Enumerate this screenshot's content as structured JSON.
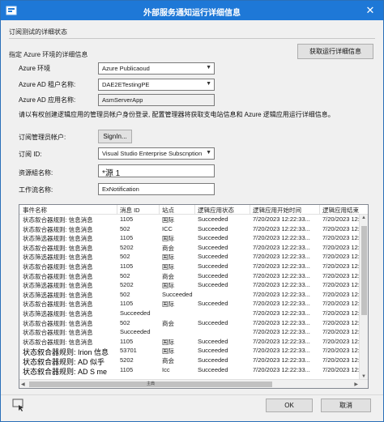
{
  "window": {
    "title": "外部服务通知运行详细信息",
    "close_glyph": "✕"
  },
  "subscription_section": "订阅测试的详细状态",
  "azure_section": "指定 Azure 环境的详细信息",
  "get_details_button": "获取运行详细信息",
  "form": {
    "env_label": "Azure 环境",
    "env_value": "Azure Publicaoud",
    "tenant_label": "Azure AD 租户名称:",
    "tenant_value": "DAE2ETestingPE",
    "app_label": "Azure AD 应用名称:",
    "app_value": "AsmServerApp",
    "note": "请以有权创建逻辑应用的管理员帐户身份登录, 配置管理器将获取支电站信息和 Azure 逻辑应用运行详细信息。",
    "admin_label": "订阅管理员帐户:",
    "signin_label": "SignIn...",
    "sub_id_label": "订阅 ID:",
    "sub_id_value": "Visual Studio Enterprise Subscnption",
    "rg_label": "资源組名称:",
    "rg_value": "*源 1",
    "workflow_label": "工作流名称:",
    "workflow_value": "ExNotification"
  },
  "grid": {
    "columns": [
      "事件名称",
      "消息 ID",
      "站点",
      "逻辑应用状态",
      "逻辑应用开始时间",
      "逻辑应用结束"
    ],
    "rows": [
      {
        "event": "状态叙合器规则: 信息消息",
        "msg": "1105",
        "site": "国际",
        "status": "Succeeded",
        "start": "7/20/2023 12:22:33...",
        "end": "7/20/2023 12:23:"
      },
      {
        "event": "状态叙合器规则: 信息消息",
        "msg": "502",
        "site": "ICC",
        "status": "Succeeded",
        "start": "7/20/2023 12:22:33...",
        "end": "7/20/2023 12:22:"
      },
      {
        "event": "状态筛选器规则: 信息消息",
        "msg": "1105",
        "site": "国际",
        "status": "Succeeded",
        "start": "7/20/2023 12:22:33...",
        "end": "7/20/2023 12:22:"
      },
      {
        "event": "状态叙合器规则: 信息消息",
        "msg": "5202",
        "site": "商会",
        "status": "Succeeded",
        "start": "7/20/2023 12:22:33...",
        "end": "7/20/2023 12:22:"
      },
      {
        "event": "状态筛选器规则: 信息消息",
        "msg": "502",
        "site": "国际",
        "status": "Succeeded",
        "start": "7/20/2023 12:22:33...",
        "end": "7/20/2023 12:22:"
      },
      {
        "event": "状态叙合器规则: 信息消息",
        "msg": "1105",
        "site": "国际",
        "status": "Succeeded",
        "start": "7/20/2023 12:22:33...",
        "end": "7/20/2023 12:22:"
      },
      {
        "event": "状态叙合器规则: 信息消息",
        "msg": "502",
        "site": "商会",
        "status": "Succeeded",
        "start": "7/20/2023 12:22:33...",
        "end": "7/20/2023 12:22:"
      },
      {
        "event": "状态筛选器规则: 信息消息",
        "msg": "5202",
        "site": "国际",
        "status": "Succeeded",
        "start": "7/20/2023 12:22:33...",
        "end": "7/20/2023 12:22:"
      },
      {
        "event": "状态筛选器规则: 信息消息",
        "msg": "502",
        "site": "Succeeded",
        "status": "",
        "start": "7/20/2023 12:22:33...",
        "end": "7/20/2023 12:22:"
      },
      {
        "event": "状态叙合器规则: 信息消息",
        "msg": "1105",
        "site": "国际",
        "status": "Succeeded",
        "start": "7/20/2023 12:22:33...",
        "end": "7/20/2023 12:22:"
      },
      {
        "event": "状态筛选器规则: 信息消息",
        "msg": "Succeeded",
        "site": "",
        "status": "",
        "start": "7/20/2023 12:22:33...",
        "end": "7/20/2023 12:22:"
      },
      {
        "event": "状态叙合器规则: 信息消息",
        "msg": "502",
        "site": "商会",
        "status": "Succeeded",
        "start": "7/20/2023 12:22:33...",
        "end": "7/20/2023 12:22:"
      },
      {
        "event": "状态叙合器规则: 信息消息",
        "msg": "Succeeded",
        "site": "",
        "status": "",
        "start": "7/20/2023 12:22:33...",
        "end": "7/20/2023 12:22:"
      },
      {
        "event": "状态叙合器规则: 信息消息",
        "msg": "1105",
        "site": "国际",
        "status": "Succeeded",
        "start": "7/20/2023 12:22:33...",
        "end": "7/20/2023 12:22:"
      },
      {
        "event": "状态叙合器规则: Irion 信息",
        "msg": "53701",
        "site": "国际",
        "status": "Succeeded",
        "start": "7/20/2023 12:22:33...",
        "end": "7/20/2023 12:22:"
      },
      {
        "event": "状态叙合器规则: AD 似乎",
        "msg": "5202",
        "site": "商会",
        "status": "Succeeded",
        "start": "7/20/2023 12:22:33...",
        "end": "7/20/2023 12:22:"
      },
      {
        "event": "状态叙合器规则: AD S me",
        "msg": "1105",
        "site": "Icc",
        "status": "Succeeded",
        "start": "7/20/2023 12:22:33...",
        "end": "7/20/2023 12:22:"
      }
    ],
    "hscroll_label": "主典"
  },
  "ok_label": "OK",
  "cancel_label": "取消"
}
